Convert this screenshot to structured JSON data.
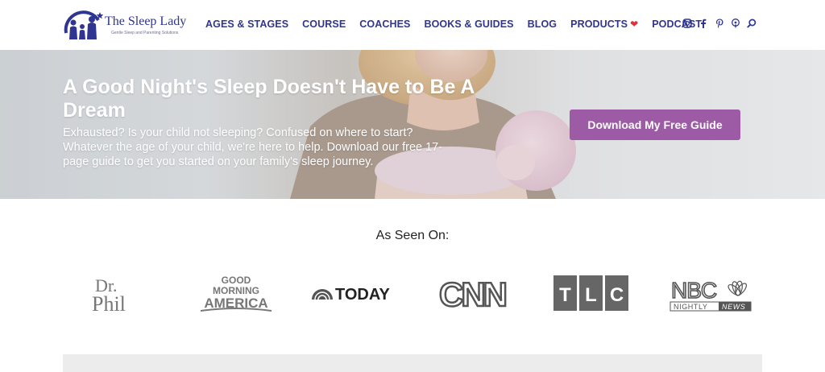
{
  "brand": {
    "name": "The Sleep Lady",
    "tagline": "Gentle Sleep and Parenting Solutions",
    "logo_icon": "family-silhouette-logo"
  },
  "nav": {
    "items": [
      {
        "label": "AGES & STAGES"
      },
      {
        "label": "COURSE"
      },
      {
        "label": "COACHES"
      },
      {
        "label": "BOOKS & GUIDES"
      },
      {
        "label": "BLOG"
      },
      {
        "label": "PRODUCTS",
        "icon": "heart-icon"
      },
      {
        "label": "PODCAST"
      }
    ],
    "heart_glyph": "❤"
  },
  "social": {
    "icons": [
      "instagram-icon",
      "facebook-icon",
      "pinterest-icon",
      "podcast-icon",
      "search-icon"
    ]
  },
  "hero": {
    "title": "A Good Night's Sleep Doesn't Have to Be A Dream",
    "text": "Exhausted? Is your child not sleeping? Confused on where to start? Whatever the age of your child, we're here to help. Download our free 17-page guide to get you started on your family's sleep journey.",
    "cta_label": "Download My Free Guide"
  },
  "seen_on": {
    "heading": "As Seen On:",
    "logos": [
      {
        "name": "Dr. Phil",
        "line1": "Dr.",
        "line2": "Phil"
      },
      {
        "name": "Good Morning America",
        "line1": "GOOD",
        "line2": "MORNING",
        "line3": "AMERICA"
      },
      {
        "name": "Today",
        "text": "TODAY"
      },
      {
        "name": "CNN",
        "text": "CNN"
      },
      {
        "name": "TLC",
        "letters": [
          "T",
          "L",
          "C"
        ]
      },
      {
        "name": "NBC Nightly News",
        "line1": "NBC",
        "line2a": "NIGHTLY",
        "line2b": "NEWS"
      }
    ]
  },
  "colors": {
    "brand_navy": "#2f3590",
    "cta_purple": "#9c5ba4",
    "heart_red": "#e0303c",
    "logo_gray": "#777777"
  }
}
